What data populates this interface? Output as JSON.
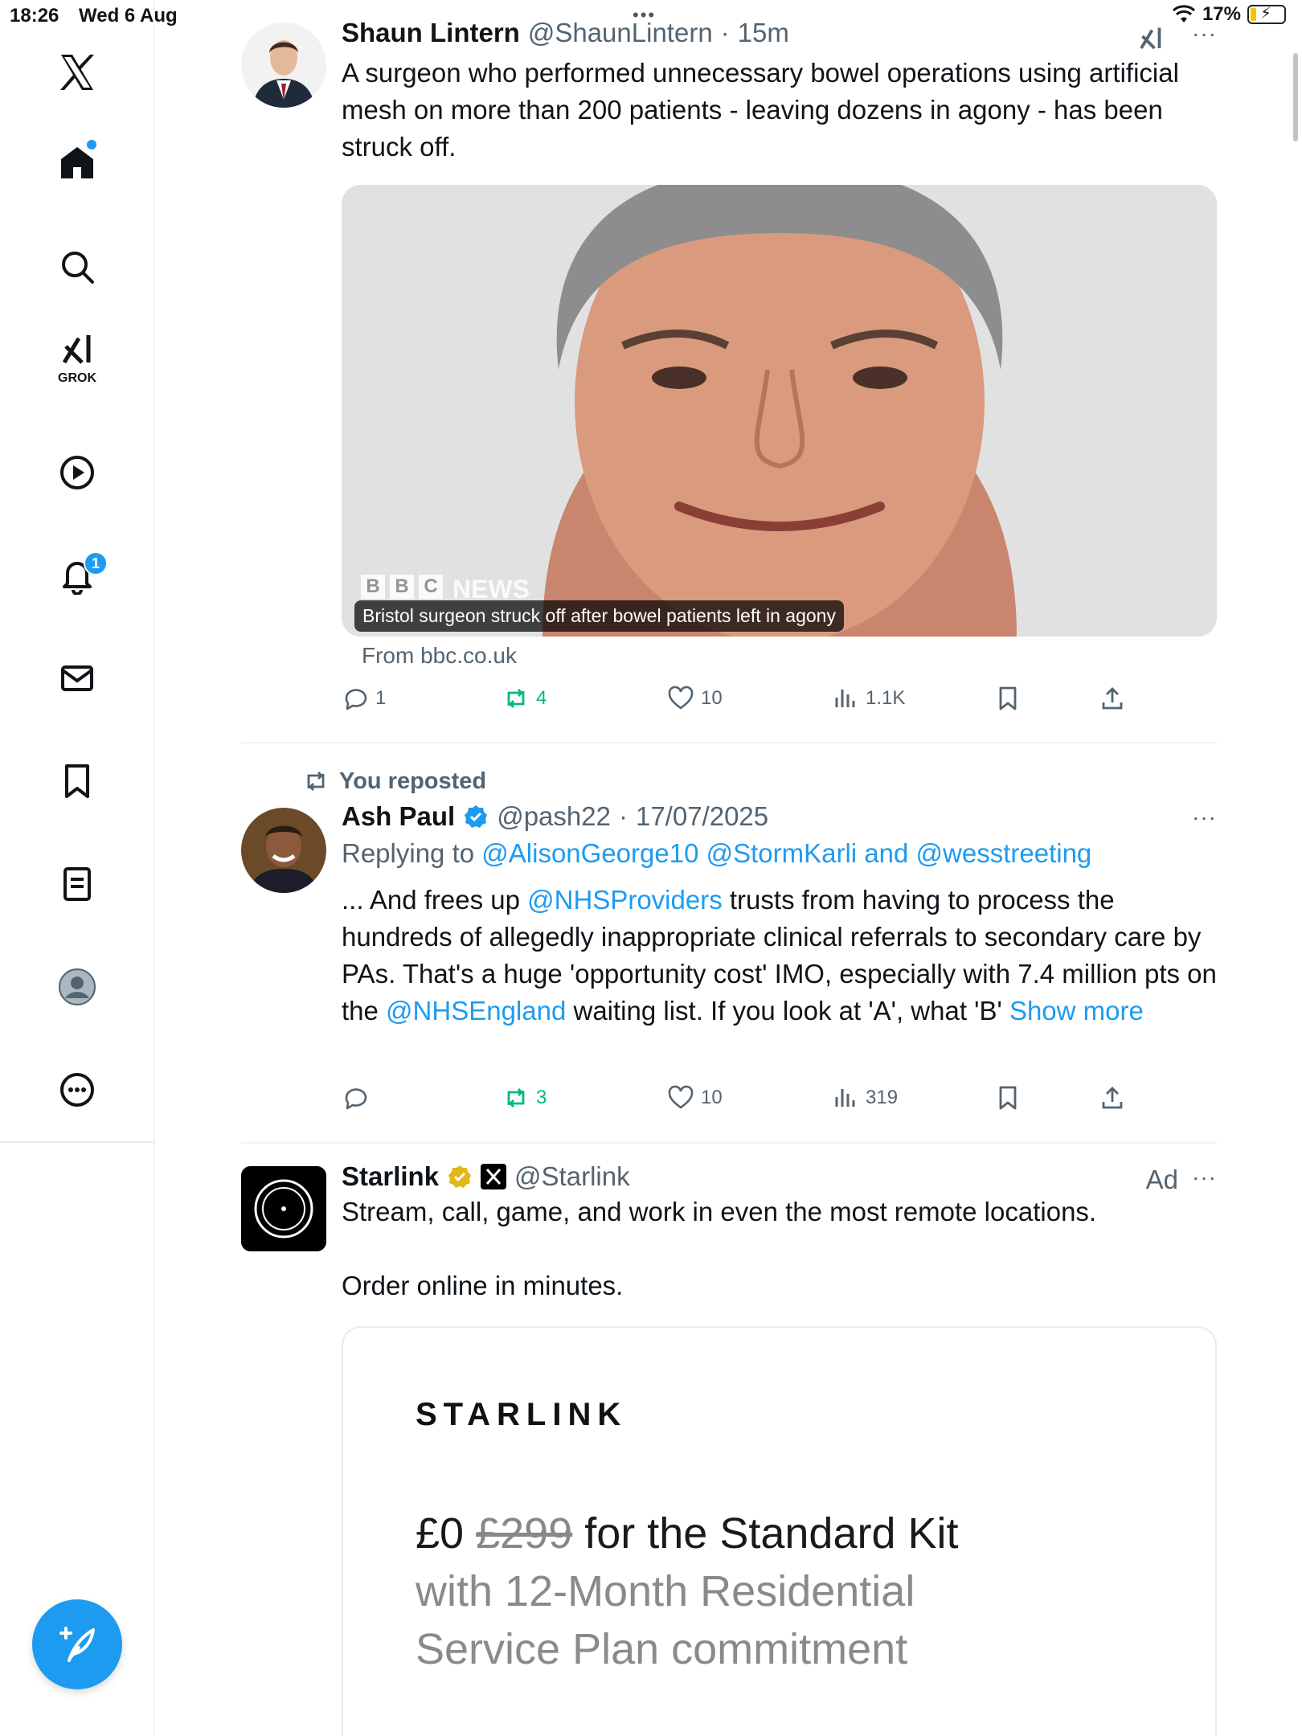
{
  "status_bar": {
    "time": "18:26",
    "date": "Wed 6 Aug",
    "battery": "17%",
    "battery_level": 0.17
  },
  "nav": {
    "grok_label": "GROK",
    "notifications_badge": "1",
    "items": [
      "x-logo",
      "home-icon",
      "search-icon",
      "grok-icon",
      "video-icon",
      "notifications-icon",
      "messages-icon",
      "bookmarks-icon",
      "lists-icon",
      "profile-icon",
      "more-icon"
    ]
  },
  "posts": [
    {
      "name": "Shaun Lintern",
      "handle": "@ShaunLintern",
      "sep": "·",
      "time": "15m",
      "more": "···",
      "text": "A surgeon who performed unnecessary bowel operations using artificial mesh on more than 200 patients - leaving dozens in agony - has been struck off.",
      "media_caption": "Bristol surgeon struck off after bowel patients left in agony",
      "media_logo": "NEWS",
      "from": "From bbc.co.uk",
      "stats": {
        "replies": "1",
        "reposts": "4",
        "likes": "10",
        "views": "1.1K"
      }
    },
    {
      "repost_label": "You reposted",
      "name": "Ash Paul",
      "handle": "@pash22",
      "sep": "·",
      "time": "17/07/2025",
      "more": "···",
      "replying_prefix": "Replying to",
      "replying_to": "@AlisonGeorge10 @StormKarli and @wesstreeting",
      "text_part1": "... And frees up ",
      "mention1": "@NHSProviders",
      "text_part2": " trusts from having to process the hundreds of allegedly inappropriate clinical referrals to secondary care by PAs. That's a huge 'opportunity cost' IMO, especially with 7.4 million pts on the ",
      "mention2": "@NHSEngland",
      "text_part3": " waiting list. If you look at 'A', what 'B' ",
      "show_more": "Show more",
      "stats": {
        "replies": "",
        "reposts": "3",
        "likes": "10",
        "views": "319"
      }
    },
    {
      "name": "Starlink",
      "handle": "@Starlink",
      "ad_label": "Ad",
      "more": "···",
      "text_line1": "Stream, call, game, and work in even the most remote locations.",
      "text_line2": "Order online in minutes.",
      "ad_brand": "STARLINK",
      "ad_price_new": "£0",
      "ad_price_old": "£299",
      "ad_headline": "for the Standard Kit",
      "ad_sub1": "with 12-Month Residential",
      "ad_sub2": "Service Plan commitment"
    }
  ]
}
